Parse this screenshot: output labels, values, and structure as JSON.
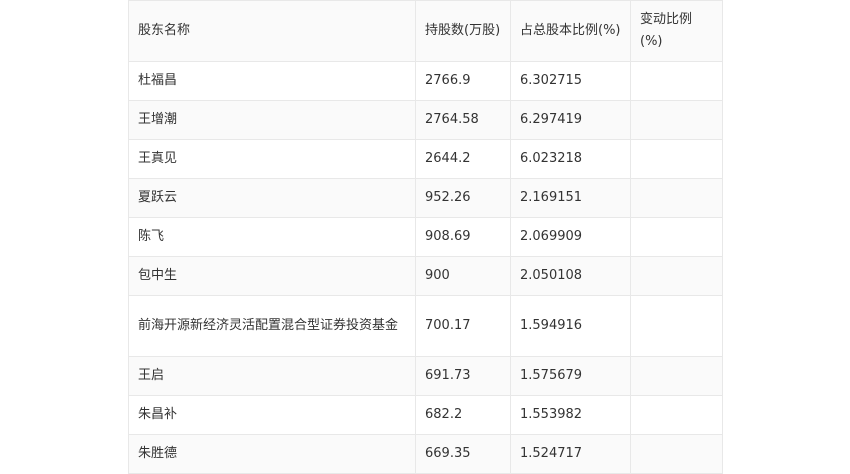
{
  "table": {
    "headers": [
      "股东名称",
      "持股数(万股)",
      "占总股本比例(%)",
      "变动比例(%)"
    ],
    "rows": [
      {
        "name": "杜福昌",
        "shares": "2766.9",
        "ratio": "6.302715",
        "change": ""
      },
      {
        "name": "王增潮",
        "shares": "2764.58",
        "ratio": "6.297419",
        "change": ""
      },
      {
        "name": "王真见",
        "shares": "2644.2",
        "ratio": "6.023218",
        "change": ""
      },
      {
        "name": "夏跃云",
        "shares": "952.26",
        "ratio": "2.169151",
        "change": ""
      },
      {
        "name": "陈飞",
        "shares": "908.69",
        "ratio": "2.069909",
        "change": ""
      },
      {
        "name": "包中生",
        "shares": "900",
        "ratio": "2.050108",
        "change": ""
      },
      {
        "name": "前海开源新经济灵活配置混合型证券投资基金",
        "shares": "700.17",
        "ratio": "1.594916",
        "change": ""
      },
      {
        "name": "王启",
        "shares": "691.73",
        "ratio": "1.575679",
        "change": ""
      },
      {
        "name": "朱昌补",
        "shares": "682.2",
        "ratio": "1.553982",
        "change": ""
      },
      {
        "name": "朱胜德",
        "shares": "669.35",
        "ratio": "1.524717",
        "change": ""
      }
    ]
  }
}
